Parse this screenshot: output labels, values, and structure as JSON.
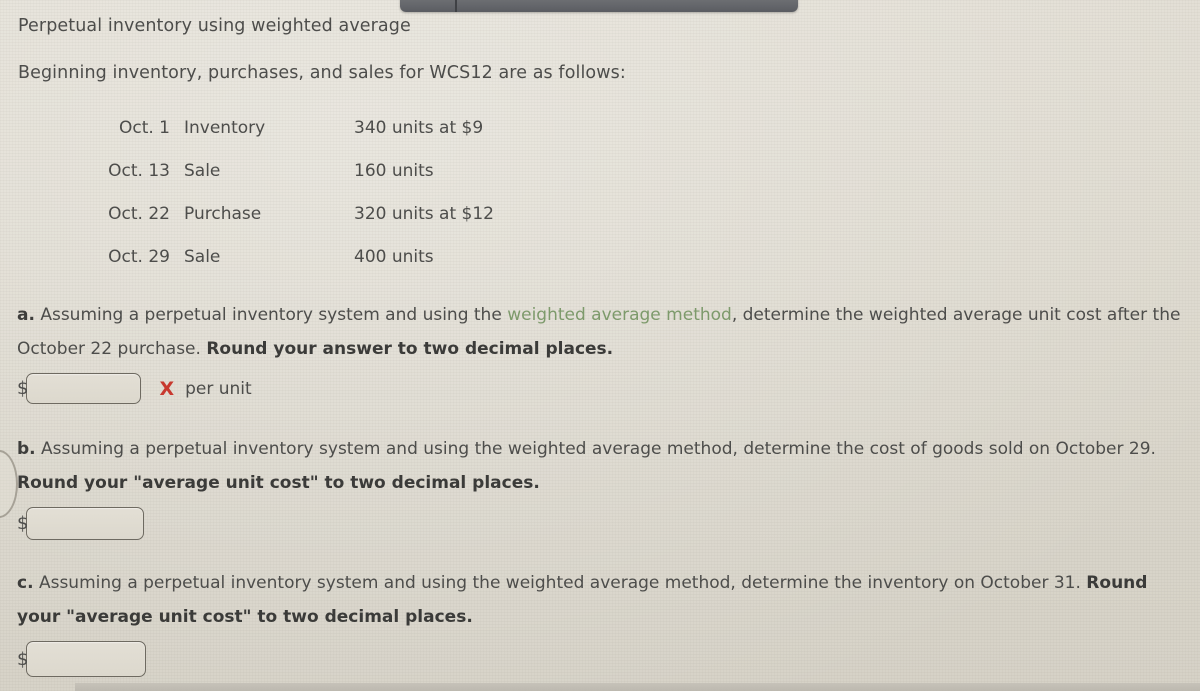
{
  "document": {
    "title": "Perpetual inventory using weighted average",
    "subtitle": "Beginning inventory, purchases, and sales for WCS12 are as follows:"
  },
  "transactions": {
    "rows": [
      {
        "date": "Oct. 1",
        "type": "Inventory",
        "detail": "340 units at $9"
      },
      {
        "date": "Oct. 13",
        "type": "Sale",
        "detail": "160 units"
      },
      {
        "date": "Oct. 22",
        "type": "Purchase",
        "detail": "320 units at $12"
      },
      {
        "date": "Oct. 29",
        "type": "Sale",
        "detail": "400 units"
      }
    ]
  },
  "questions": {
    "a": {
      "label": "a.",
      "text_before_link": "Assuming a perpetual inventory system and using the ",
      "link_text": "weighted average method",
      "text_after_link": ", determine the weighted average unit cost after the October 22 purchase. ",
      "instruction": "Round your answer to two decimal places.",
      "currency_symbol": "$",
      "input_value": "",
      "input_placeholder": "",
      "mark": "X",
      "mark_color": "#c8392f",
      "suffix": "per unit"
    },
    "b": {
      "label": "b.",
      "text": "Assuming a perpetual inventory system and using the weighted average method, determine the cost of goods sold on October 29. ",
      "instruction": "Round your \"average unit cost\" to two decimal places.",
      "currency_symbol": "$",
      "input_value": "",
      "input_placeholder": ""
    },
    "c": {
      "label": "c.",
      "text": "Assuming a perpetual inventory system and using the weighted average method, determine the inventory on October 31. ",
      "instruction": "Round your \"average unit cost\" to two decimal places.",
      "currency_symbol": "$",
      "input_value": "",
      "input_placeholder": ""
    }
  },
  "theme": {
    "background": "#dedacf",
    "text": "#4d4d4b",
    "link_green": "#7d9a6b",
    "error_red": "#c8392f",
    "bezel_gray": "#63656a"
  }
}
